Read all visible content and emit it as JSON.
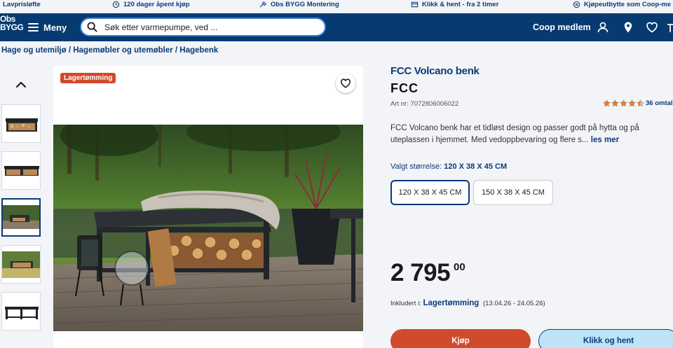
{
  "usp_bar": {
    "items": [
      {
        "icon": "tag-icon",
        "label": "Lavprisløfte"
      },
      {
        "icon": "return-icon",
        "label": "120 dager åpent kjøp"
      },
      {
        "icon": "tools-icon",
        "label": "Obs BYGG Montering"
      },
      {
        "icon": "store-icon",
        "label": "Klikk & hent - fra 2 timer"
      },
      {
        "icon": "exchange-icon",
        "label": "Kjøpeutbytte som Coop-me"
      }
    ]
  },
  "header": {
    "logo_line1": "Obs",
    "logo_line2": "BYGG",
    "menu_label": "Meny",
    "search_placeholder": "Søk etter varmepumpe, ved ...",
    "member_label": "Coop medlem",
    "icons": [
      "user-icon",
      "location-icon",
      "heart-icon",
      "cart-icon"
    ]
  },
  "breadcrumb": "Hage og utemiljø / Hagemøbler og utemøbler / Hagebenk",
  "gallery": {
    "badge": "Lagertømming",
    "active_thumbnail": 3
  },
  "product": {
    "title": "FCC Volcano benk",
    "brand": "FCC",
    "article_number": "Art nr: 7072806006022",
    "rating_value": 4.5,
    "rating_count": "36 omtal",
    "description": "FCC Volcano benk har et tidløst design og passer godt på hytta og på uteplassen i hjemmet. Med vedoppbevaring og flere s...",
    "read_more": "les mer",
    "size_label": "Valgt størrelse:",
    "size_selected": "120 X 38 X 45 CM",
    "sizes": [
      "120 X 38 X 45 CM",
      "150 X 38 X 45 CM"
    ],
    "price_main": "2 795",
    "price_decimals": "00",
    "included_prefix": "Inkludert i:",
    "campaign": "Lagertømming",
    "campaign_dates": "(13.04.26 - 24.05.26)",
    "buy_label": "Kjøp",
    "collect_label": "Klikk og hent"
  },
  "colors": {
    "primary": "#063a70",
    "accent": "#d04a2b",
    "light_blue": "#bfe3f6"
  }
}
